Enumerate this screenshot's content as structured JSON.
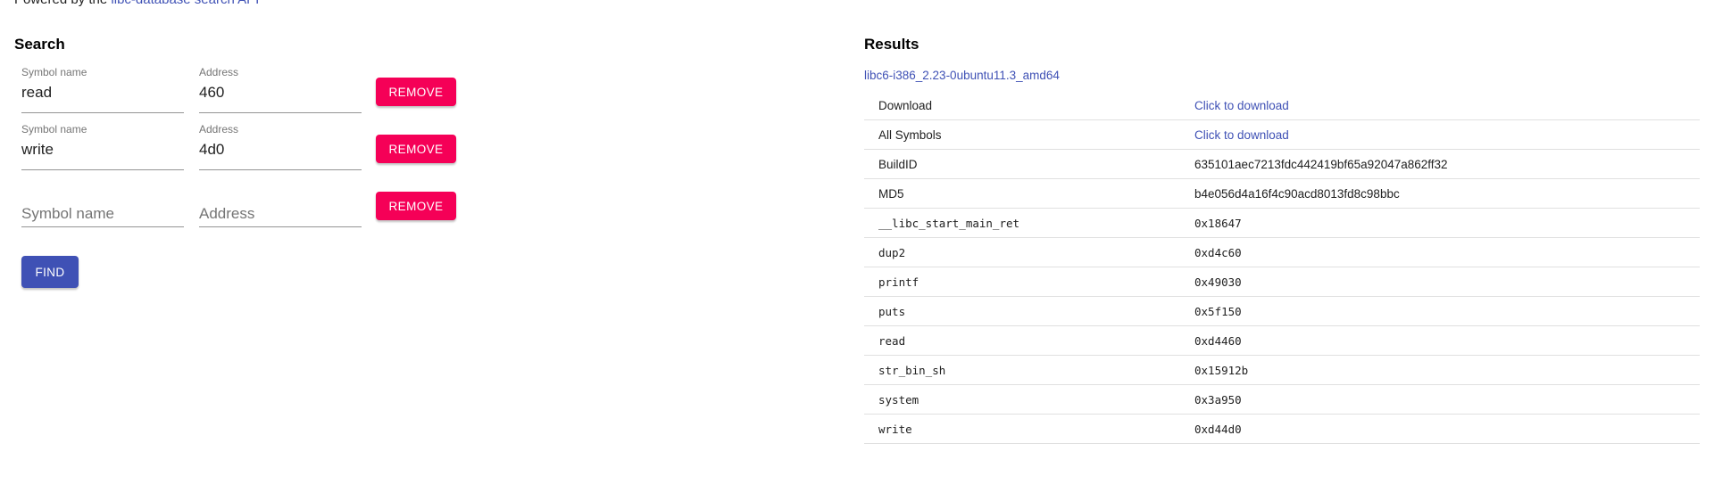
{
  "header": {
    "powered_prefix": "Powered by the",
    "powered_link": "libc-database search API"
  },
  "search": {
    "title": "Search",
    "rows": [
      {
        "symbol_label": "Symbol name",
        "symbol_value": "read",
        "address_label": "Address",
        "address_value": "460",
        "remove_label": "REMOVE"
      },
      {
        "symbol_label": "Symbol name",
        "symbol_value": "write",
        "address_label": "Address",
        "address_value": "4d0",
        "remove_label": "REMOVE"
      },
      {
        "symbol_placeholder": "Symbol name",
        "address_placeholder": "Address",
        "remove_label": "REMOVE"
      }
    ],
    "find_label": "FIND"
  },
  "results": {
    "title": "Results",
    "library": "libc6-i386_2.23-0ubuntu11.3_amd64",
    "info": [
      {
        "key": "Download",
        "value": "Click to download"
      },
      {
        "key": "All Symbols",
        "value": "Click to download"
      },
      {
        "key": "BuildID",
        "value": "635101aec7213fdc442419bf65a92047a862ff32"
      },
      {
        "key": "MD5",
        "value": "b4e056d4a16f4c90acd8013fd8c98bbc"
      }
    ],
    "symbols": [
      {
        "name": "__libc_start_main_ret",
        "addr": "0x18647"
      },
      {
        "name": "dup2",
        "addr": "0xd4c60"
      },
      {
        "name": "printf",
        "addr": "0x49030"
      },
      {
        "name": "puts",
        "addr": "0x5f150"
      },
      {
        "name": "read",
        "addr": "0xd4460"
      },
      {
        "name": "str_bin_sh",
        "addr": "0x15912b"
      },
      {
        "name": "system",
        "addr": "0x3a950"
      },
      {
        "name": "write",
        "addr": "0xd44d0"
      }
    ]
  },
  "colors": {
    "primary": "#3f51b5",
    "secondary": "#f50057"
  }
}
